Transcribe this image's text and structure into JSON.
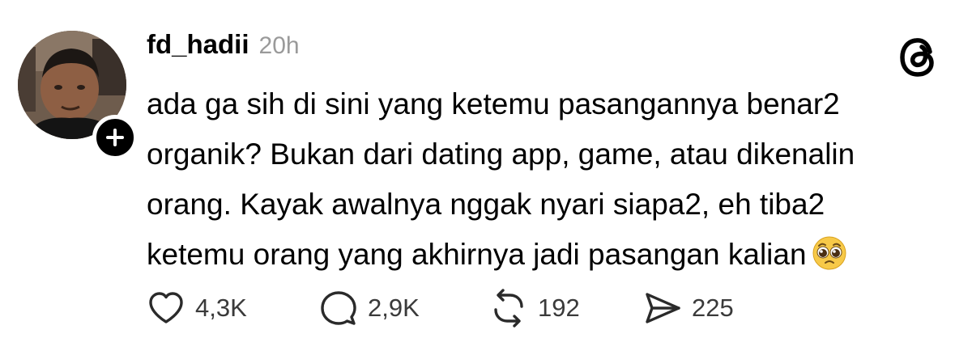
{
  "post": {
    "username": "fd_hadii",
    "timestamp": "20h",
    "text_lines": [
      "ada ga sih di sini yang ketemu pasangannya benar2",
      "organik? Bukan dari dating app, game, atau dikenalin",
      "orang. Kayak awalnya nggak nyari siapa2, eh tiba2",
      "ketemu orang yang akhirnya jadi pasangan kalian"
    ],
    "emoji": "pleading-face"
  },
  "actions": {
    "likes": "4,3K",
    "replies": "2,9K",
    "reposts": "192",
    "shares": "225"
  },
  "icons": {
    "brand": "threads-logo-icon",
    "follow": "plus-icon",
    "like": "heart-icon",
    "reply": "speech-bubble-icon",
    "repost": "repost-arrows-icon",
    "share": "send-icon"
  },
  "colors": {
    "text": "#000000",
    "timestamp": "#9a9a9a",
    "count": "#3a3a3a",
    "icon": "#2a2a2a",
    "background": "#ffffff"
  }
}
